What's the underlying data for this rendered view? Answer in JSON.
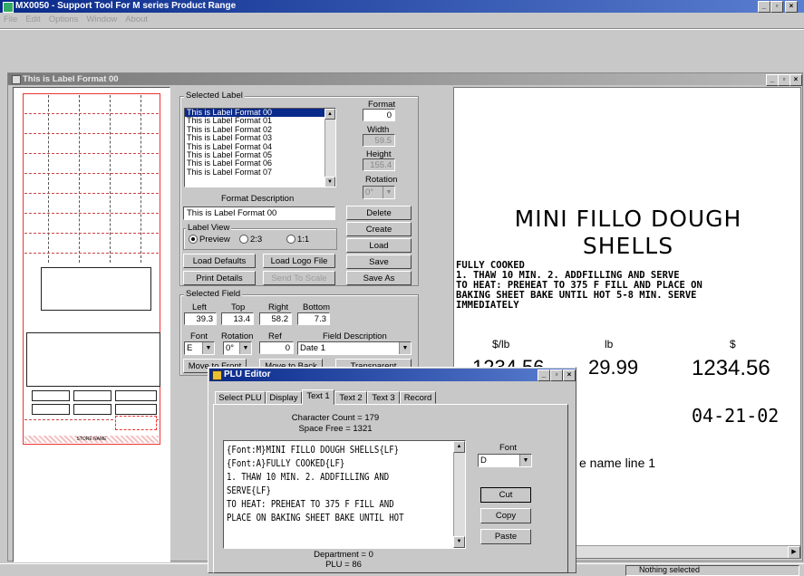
{
  "app": {
    "title": "MX0050 - Support Tool For M series Product Range",
    "menu": [
      "File",
      "Edit",
      "Options",
      "Window",
      "About"
    ]
  },
  "label_window": {
    "title": "This is Label Format 00"
  },
  "label_canvas": {
    "store_name": "STORE NAME"
  },
  "selected_label": {
    "group_title": "Selected Label",
    "formats": [
      "This is Label Format 00",
      "This is Label Format 01",
      "This is Label Format 02",
      "This is Label Format 03",
      "This is Label Format 04",
      "This is Label Format 05",
      "This is Label Format 06",
      "This is Label Format 07"
    ],
    "format_label": "Format",
    "format_value": "0",
    "width_label": "Width",
    "width_value": "59.5",
    "height_label": "Height",
    "height_value": "155.4",
    "rotation_label": "Rotation",
    "rotation_value": "0°",
    "format_description_label": "Format Description",
    "format_description_value": "This is Label Format 00",
    "label_view": {
      "title": "Label View",
      "preview": "Preview",
      "ratio_23": "2:3",
      "ratio_11": "1:1"
    },
    "buttons": {
      "delete": "Delete",
      "create": "Create",
      "load": "Load",
      "save": "Save",
      "save_as": "Save As",
      "load_defaults": "Load Defaults",
      "load_logo_file": "Load Logo File",
      "print_details": "Print Details",
      "send_to_scale": "Send To Scale"
    }
  },
  "selected_field": {
    "group_title": "Selected Field",
    "left_label": "Left",
    "left_value": "39.3",
    "top_label": "Top",
    "top_value": "13.4",
    "right_label": "Right",
    "right_value": "58.2",
    "bottom_label": "Bottom",
    "bottom_value": "7.3",
    "font_label": "Font",
    "font_value": "E",
    "rotation_label": "Rotation",
    "rotation_value": "0°",
    "ref_label": "Ref",
    "ref_value": "0",
    "field_description_label": "Field Description",
    "field_description_value": "Date 1",
    "move_to_front": "Move to Front",
    "move_to_back": "Move to Back",
    "transparent": "Transparent"
  },
  "preview": {
    "title_line1": "MINI FILLO DOUGH",
    "title_line2": "SHELLS",
    "body": [
      "FULLY COOKED",
      "1. THAW 10 MIN. 2. ADDFILLING AND SERVE",
      "TO HEAT: PREHEAT TO 375 F FILL AND PLACE ON",
      "BAKING SHEET BAKE UNTIL HOT 5-8 MIN. SERVE",
      "IMMEDIATELY"
    ],
    "per_lb_label": "$/lb",
    "lb_label": "lb",
    "dollar_label": "$",
    "per_lb_value": "1234.56",
    "lb_value": "29.99",
    "total_value": "1234.56",
    "date_value": "04-21-02",
    "store_line": "e name line 1"
  },
  "plu_editor": {
    "title": "PLU Editor",
    "tabs": [
      "Select PLU",
      "Display",
      "Text 1",
      "Text 2",
      "Text 3",
      "Record"
    ],
    "active_tab": "Text 1",
    "character_count": "Character Count = 179",
    "space_free": "Space Free = 1321",
    "text_lines": [
      "{Font:M}MINI FILLO DOUGH SHELLS{LF}",
      "{Font:A}FULLY COOKED{LF}",
      "1. THAW 10 MIN. 2. ADDFILLING AND",
      "SERVE{LF}",
      "TO HEAT: PREHEAT TO 375 F FILL AND",
      "PLACE ON BAKING SHEET BAKE UNTIL HOT"
    ],
    "font_label": "Font",
    "font_value": "D",
    "cut": "Cut",
    "copy": "Copy",
    "paste": "Paste",
    "department": "Department = 0",
    "plu": "PLU = 86"
  },
  "status": {
    "text": "Nothing selected"
  },
  "colors": {
    "title_active": "#0a2a8a",
    "title_inactive": "#7a7a7a",
    "face": "#c8c8c8"
  }
}
